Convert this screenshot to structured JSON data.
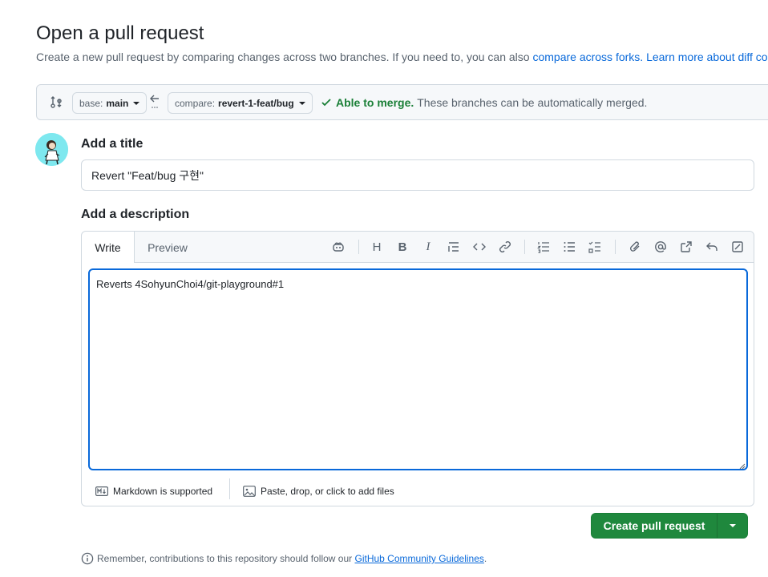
{
  "page": {
    "title": "Open a pull request",
    "subtitle_prefix": "Create a new pull request by comparing changes across two branches. If you need to, you can also",
    "subtitle_link_forks": "compare across forks.",
    "subtitle_link_learn": "Learn more about diff com"
  },
  "compare_bar": {
    "base_label": "base:",
    "base_value": "main",
    "compare_label": "compare:",
    "compare_value": "revert-1-feat/bug",
    "merge_status": "Able to merge.",
    "merge_detail": "These branches can be automatically merged."
  },
  "form": {
    "title_label": "Add a title",
    "title_value": "Revert \"Feat/bug 구현\"",
    "description_label": "Add a description",
    "tabs": [
      "Write",
      "Preview"
    ],
    "description_value": "Reverts 4SohyunChoi4/git-playground#1",
    "markdown_note": "Markdown is supported",
    "attach_note": "Paste, drop, or click to add files"
  },
  "toolbar": {
    "heading": "H",
    "bold": "B",
    "italic": "I"
  },
  "actions": {
    "create_label": "Create pull request"
  },
  "footer": {
    "note_prefix": "Remember, contributions to this repository should follow our",
    "note_link": "GitHub Community Guidelines",
    "note_suffix": "."
  },
  "colors": {
    "accent": "#0969da",
    "success": "#1a7f37",
    "button_green": "#1f883d"
  }
}
